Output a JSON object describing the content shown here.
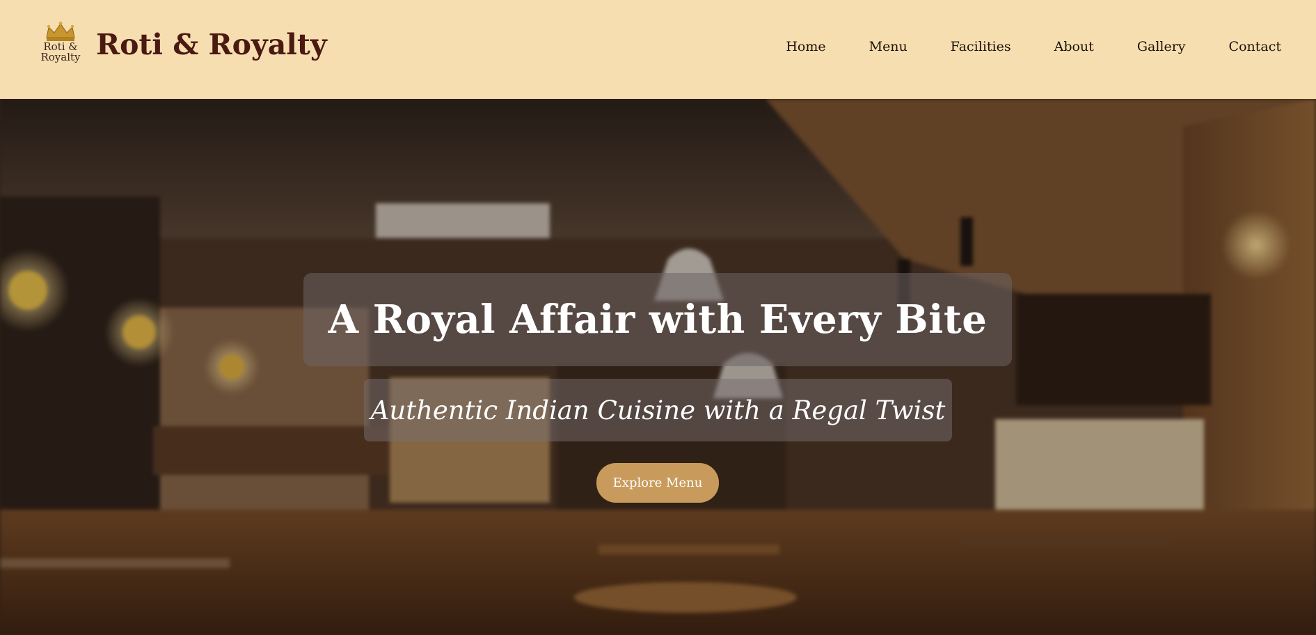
{
  "header": {
    "logo_line1": "Roti &",
    "logo_line2": "Royalty",
    "brand": "Roti & Royalty",
    "nav": [
      "Home",
      "Menu",
      "Facilities",
      "About",
      "Gallery",
      "Contact"
    ]
  },
  "hero": {
    "title": "A Royal Affair with Every Bite",
    "subtitle": "Authentic Indian Cuisine with a Regal Twist",
    "cta_label": "Explore Menu"
  },
  "colors": {
    "header_bg": "#f6deb1",
    "brand_text": "#4a1a12",
    "cta_bg": "#c89b5c"
  },
  "icons": {
    "logo": "crown-icon"
  }
}
